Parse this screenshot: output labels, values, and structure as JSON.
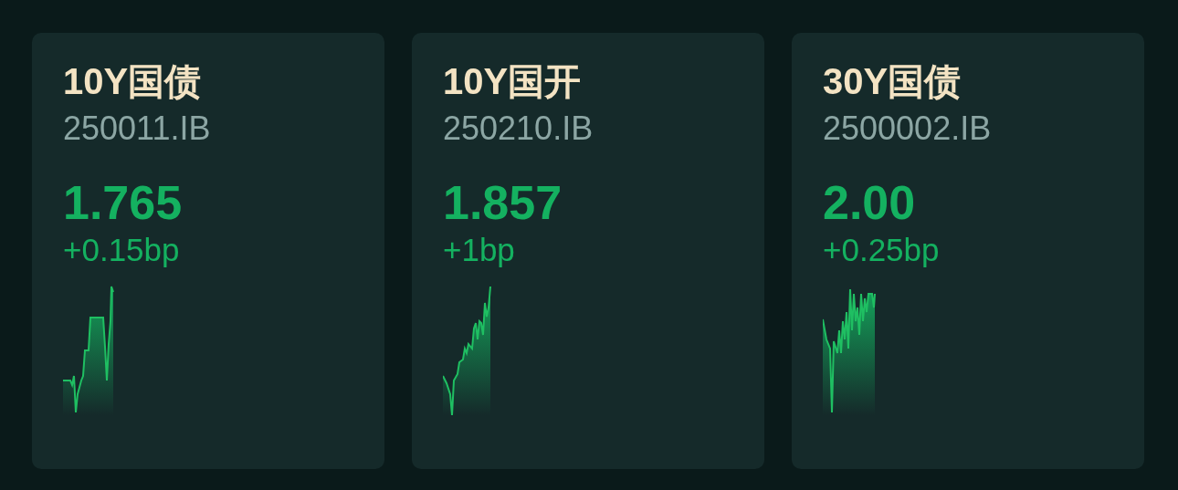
{
  "cards": [
    {
      "title": "10Y国债",
      "code": "250011.IB",
      "yield": "1.765",
      "change": "+0.15bp"
    },
    {
      "title": "10Y国开",
      "code": "250210.IB",
      "yield": "1.857",
      "change": "+1bp"
    },
    {
      "title": "30Y国债",
      "code": "2500002.IB",
      "yield": "2.00",
      "change": "+0.25bp"
    }
  ]
}
